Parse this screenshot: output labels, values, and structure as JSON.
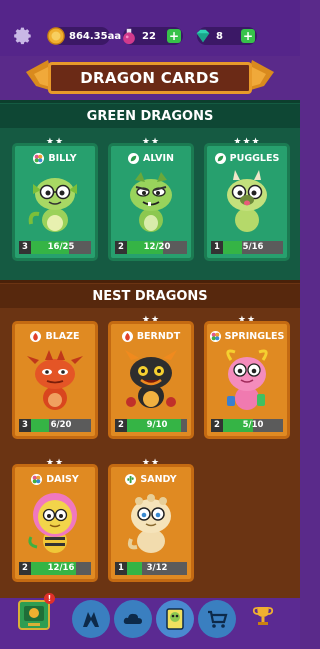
{
  "topbar": {
    "coins": "864.35aa",
    "potions": "22",
    "gems": "8",
    "plus_label": "+"
  },
  "header": {
    "title": "DRAGON CARDS"
  },
  "sections": {
    "green": {
      "title": "GREEN DRAGONS",
      "cards": [
        {
          "name": "BILLY",
          "stars": "★★",
          "level": "3",
          "count": "16/25",
          "progress": 0.64,
          "element": "flower-icon"
        },
        {
          "name": "ALVIN",
          "stars": "★★",
          "level": "2",
          "count": "12/20",
          "progress": 0.6,
          "element": "leaf-icon"
        },
        {
          "name": "PUGGLES",
          "stars": "★★★",
          "level": "1",
          "count": "5/16",
          "progress": 0.31,
          "element": "leaf-icon"
        }
      ]
    },
    "nest": {
      "title": "NEST DRAGONS",
      "cards": [
        {
          "name": "BLAZE",
          "stars": "",
          "level": "3",
          "count": "6/20",
          "progress": 0.3,
          "element": "fire-icon"
        },
        {
          "name": "BERNDT",
          "stars": "★★",
          "level": "2",
          "count": "9/10",
          "progress": 0.9,
          "element": "fire-icon"
        },
        {
          "name": "SPRINGLES",
          "stars": "★★",
          "level": "2",
          "count": "5/10",
          "progress": 0.5,
          "element": "flower-icon"
        },
        {
          "name": "DAISY",
          "stars": "★★",
          "level": "2",
          "count": "12/16",
          "progress": 0.75,
          "element": "flower-icon"
        },
        {
          "name": "SANDY",
          "stars": "★★",
          "level": "1",
          "count": "3/12",
          "progress": 0.25,
          "element": "cactus-icon"
        }
      ]
    }
  },
  "bottomnav": {
    "badge": "!",
    "items": [
      "tv-icon",
      "dragon-icon",
      "cloud-icon",
      "dragon-card-icon",
      "cart-icon",
      "trophy-icon"
    ]
  },
  "colors": {
    "purple": "#5a2a8a",
    "green_section": "#155a42",
    "nest_section": "#6b3413",
    "green_card": "#27a06e",
    "nest_card": "#e08a22",
    "progress_fill": "#35b445"
  }
}
